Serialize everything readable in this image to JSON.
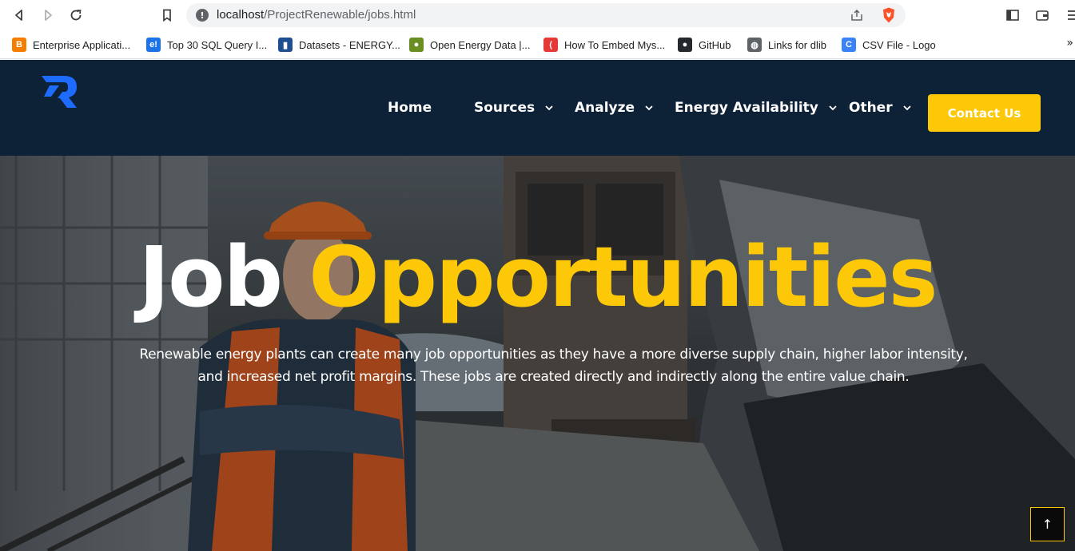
{
  "browser": {
    "url_host": "localhost",
    "url_path": "/ProjectRenewable/jobs.html",
    "bookmarks": [
      {
        "label": "Enterprise Applicati...",
        "icon": "blogger-icon",
        "color": "#f57d00",
        "glyph": "B"
      },
      {
        "label": "Top 30 SQL Query I...",
        "icon": "edureka-icon",
        "color": "#1a73e8",
        "glyph": "e!"
      },
      {
        "label": "Datasets - ENERGY...",
        "icon": "datasets-icon",
        "color": "#1d4f91",
        "glyph": "▮"
      },
      {
        "label": "Open Energy Data |...",
        "icon": "energy-seal-icon",
        "color": "#6b8e23",
        "glyph": "●"
      },
      {
        "label": "How To Embed Mys...",
        "icon": "embed-icon",
        "color": "#e53935",
        "glyph": "⟨"
      },
      {
        "label": "GitHub",
        "icon": "github-icon",
        "color": "#24292e",
        "glyph": "●"
      },
      {
        "label": "Links for dlib",
        "icon": "globe-icon",
        "color": "#5f6368",
        "glyph": "◍"
      },
      {
        "label": "CSV File - Logo",
        "icon": "csv-logo-icon",
        "color": "#3b82f6",
        "glyph": "C"
      }
    ],
    "more_bookmarks": "»"
  },
  "site": {
    "brand_color": "#1e6bff",
    "accent_color": "#fcc808",
    "nav": [
      {
        "label": "Home",
        "has_dropdown": false
      },
      {
        "label": "Sources",
        "has_dropdown": true
      },
      {
        "label": "Analyze",
        "has_dropdown": true
      },
      {
        "label": "Energy Availability",
        "has_dropdown": true
      },
      {
        "label": "Other",
        "has_dropdown": true
      }
    ],
    "contact_label": "Contact Us"
  },
  "hero": {
    "title_word1": "Job",
    "title_word2": "Opportunities",
    "description": "Renewable energy plants can create many job opportunities as they have a more diverse supply chain, higher labor intensity, and increased net profit margins. These jobs are created directly and indirectly along the entire value chain.",
    "scroll_top_glyph": "↑"
  }
}
